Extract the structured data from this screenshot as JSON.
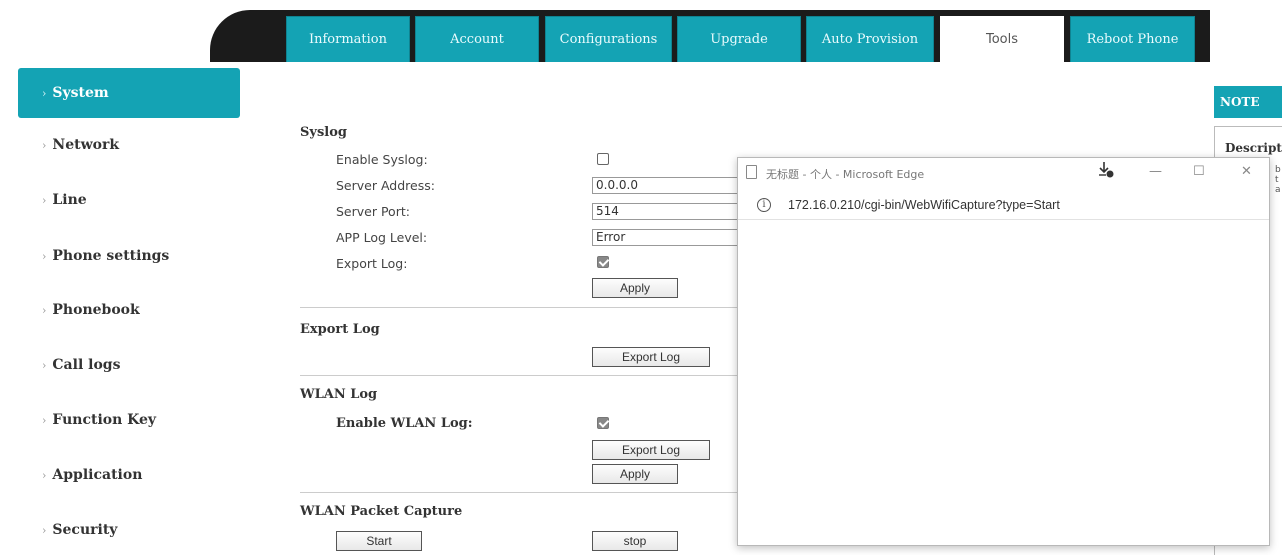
{
  "tabs": [
    {
      "label": "Information",
      "active": false
    },
    {
      "label": "Account",
      "active": false
    },
    {
      "label": "Configurations",
      "active": false
    },
    {
      "label": "Upgrade",
      "active": false
    },
    {
      "label": "Auto Provision",
      "active": false
    },
    {
      "label": "Tools",
      "active": true
    },
    {
      "label": "Reboot Phone",
      "active": false
    }
  ],
  "sidebar": {
    "items": [
      {
        "label": "System",
        "active": true
      },
      {
        "label": "Network",
        "active": false
      },
      {
        "label": "Line",
        "active": false
      },
      {
        "label": "Phone settings",
        "active": false
      },
      {
        "label": "Phonebook",
        "active": false
      },
      {
        "label": "Call logs",
        "active": false
      },
      {
        "label": "Function Key",
        "active": false
      },
      {
        "label": "Application",
        "active": false
      },
      {
        "label": "Security",
        "active": false
      }
    ],
    "chevron": "›"
  },
  "syslog": {
    "title": "Syslog",
    "enable_label": "Enable Syslog:",
    "enable_checked": false,
    "server_address_label": "Server Address:",
    "server_address_value": "0.0.0.0",
    "server_port_label": "Server Port:",
    "server_port_value": "514",
    "app_log_level_label": "APP Log Level:",
    "app_log_level_value": "Error",
    "export_log_label": "Export Log:",
    "export_log_checked": true,
    "apply_label": "Apply"
  },
  "export_log": {
    "title": "Export Log",
    "button_label": "Export Log"
  },
  "wlan_log": {
    "title": "WLAN Log",
    "enable_label": "Enable WLAN Log:",
    "enable_checked": true,
    "export_button_label": "Export Log",
    "apply_label": "Apply"
  },
  "wlan_capture": {
    "title": "WLAN Packet Capture",
    "start_label": "Start",
    "stop_label": "stop"
  },
  "note": {
    "header": "NOTE",
    "description_label": "Descript",
    "fragments": [
      "b",
      "t",
      "a"
    ]
  },
  "popup": {
    "title": "无标题 - 个人 - Microsoft Edge",
    "url": "172.16.0.210/cgi-bin/WebWifiCapture?type=Start",
    "info_icon": "info-icon",
    "download_icon": "download-icon"
  },
  "colors": {
    "accent": "#14a3b4",
    "topbar": "#1b1b1b"
  }
}
